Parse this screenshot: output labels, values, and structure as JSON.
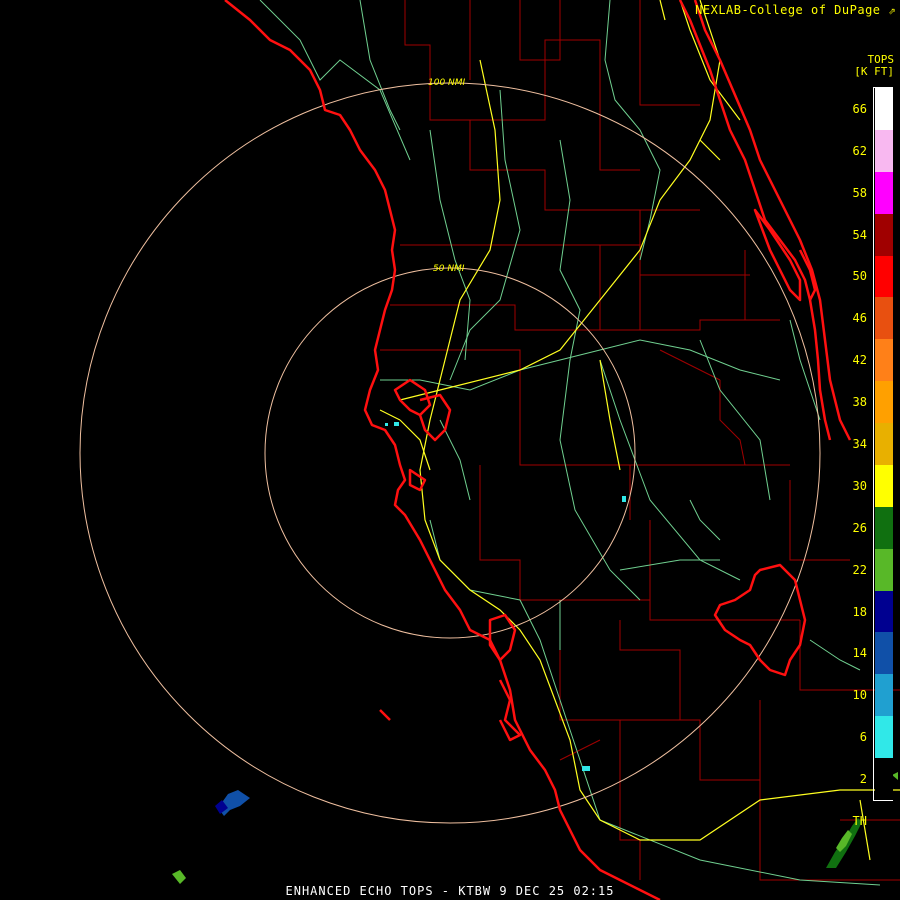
{
  "header": {
    "credit": "NEXLAB-College of DuPage"
  },
  "footer": {
    "caption": "ENHANCED ECHO TOPS - KTBW 9 DEC 25 02:15"
  },
  "map": {
    "range_rings": [
      {
        "label": "50 NMI"
      },
      {
        "label": "100 NMI"
      }
    ]
  },
  "legend": {
    "title_line1": "TOPS",
    "title_line2": "[K FT]",
    "labels": [
      "66",
      "62",
      "58",
      "54",
      "50",
      "46",
      "42",
      "38",
      "34",
      "30",
      "26",
      "22",
      "18",
      "14",
      "10",
      "6",
      "2",
      "TH"
    ],
    "colors": [
      "#ffffff",
      "#f8b8f0",
      "#ff00ff",
      "#a00000",
      "#ff0000",
      "#e85010",
      "#ff8018",
      "#ffa000",
      "#e8b000",
      "#ffff00",
      "#107010",
      "#58b828",
      "#000090",
      "#1050a8",
      "#20a0d0",
      "#30e8e8",
      "#000000"
    ]
  }
}
